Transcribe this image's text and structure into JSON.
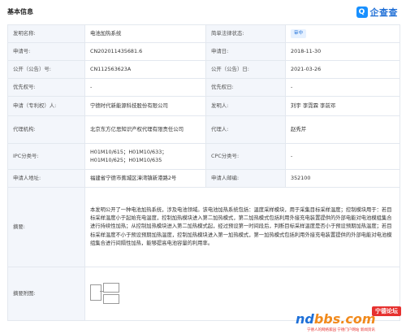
{
  "header": {
    "title": "基本信息",
    "brand_logo": "Q",
    "brand_name": "企查查"
  },
  "rows": {
    "invention_name": {
      "label": "发明名称:",
      "value": "电池加热系统"
    },
    "legal_status": {
      "label": "简单法律状态:",
      "value": "审中"
    },
    "application_no": {
      "label": "申请号:",
      "value": "CN202011435681.6"
    },
    "application_date": {
      "label": "申请日:",
      "value": "2018-11-30"
    },
    "publication_no": {
      "label": "公开（公告）号:",
      "value": "CN112563623A"
    },
    "publication_date": {
      "label": "公开（公告）日:",
      "value": "2021-03-26"
    },
    "priority_no": {
      "label": "优先权号:",
      "value": "-"
    },
    "priority_date": {
      "label": "优先权日:",
      "value": "-"
    },
    "applicant": {
      "label": "申请（专利权）人:",
      "value": "宁德时代新能源科技股份有限公司"
    },
    "inventor": {
      "label": "发明人:",
      "value": "刘宇 李霓霖 李前邓"
    },
    "agency": {
      "label": "代理机构:",
      "value": "北京东方亿思知识产权代理有限责任公司"
    },
    "agent": {
      "label": "代理人:",
      "value": "赵秀芹"
    },
    "ipc": {
      "label": "IPC分类号:",
      "value": "H01M10/615；H01M10/633；H01M10/625；H01M10/635"
    },
    "cpc": {
      "label": "CPC分类号:",
      "value": "-"
    },
    "address": {
      "label": "申请人地址:",
      "value": "福建省宁德市蕉城区漳湾镇新港路2号"
    },
    "postcode": {
      "label": "申请人邮编:",
      "value": "352100"
    },
    "abstract": {
      "label": "摘要:",
      "value": "本发明公开了一种电池加热系统，涉及电池领域。该电池加热系统包括：温度采样模块，用于采集目标采样温度；控制模块用于：若目标采样温度小于起始充电温度，控制加热模块进入第二加热模式，第二加热模式包括利用外接充电装置提供的外部电能对电池模组集合进行持续性加热；从控制加热模块进入第二加热模式起，经过预设第一时间段后，判断目标采样温度是否小于预设预期加热温度；若目标采样温度不小于预设预期加热温度，控制加热模块进入第一加热模式，第一加热模式包括利用外接充电装置提供的外部电能对电池模组集合进行间隔性加热，能够提高电池容量的利用率。"
    },
    "figure": {
      "label": "摘要附图:"
    }
  },
  "watermark": {
    "tag": "宁德论坛",
    "main_prefix": "nd",
    "main_rest": "bbs.com",
    "sub": "宁德人的网络家园 宁德门户网站 新闻资讯"
  },
  "colors": {
    "accent": "#1e70d8",
    "label_bg": "#f3f6fb",
    "border": "#e3e8ef",
    "watermark_orange": "#f18a1c",
    "watermark_red": "#e6312f"
  }
}
